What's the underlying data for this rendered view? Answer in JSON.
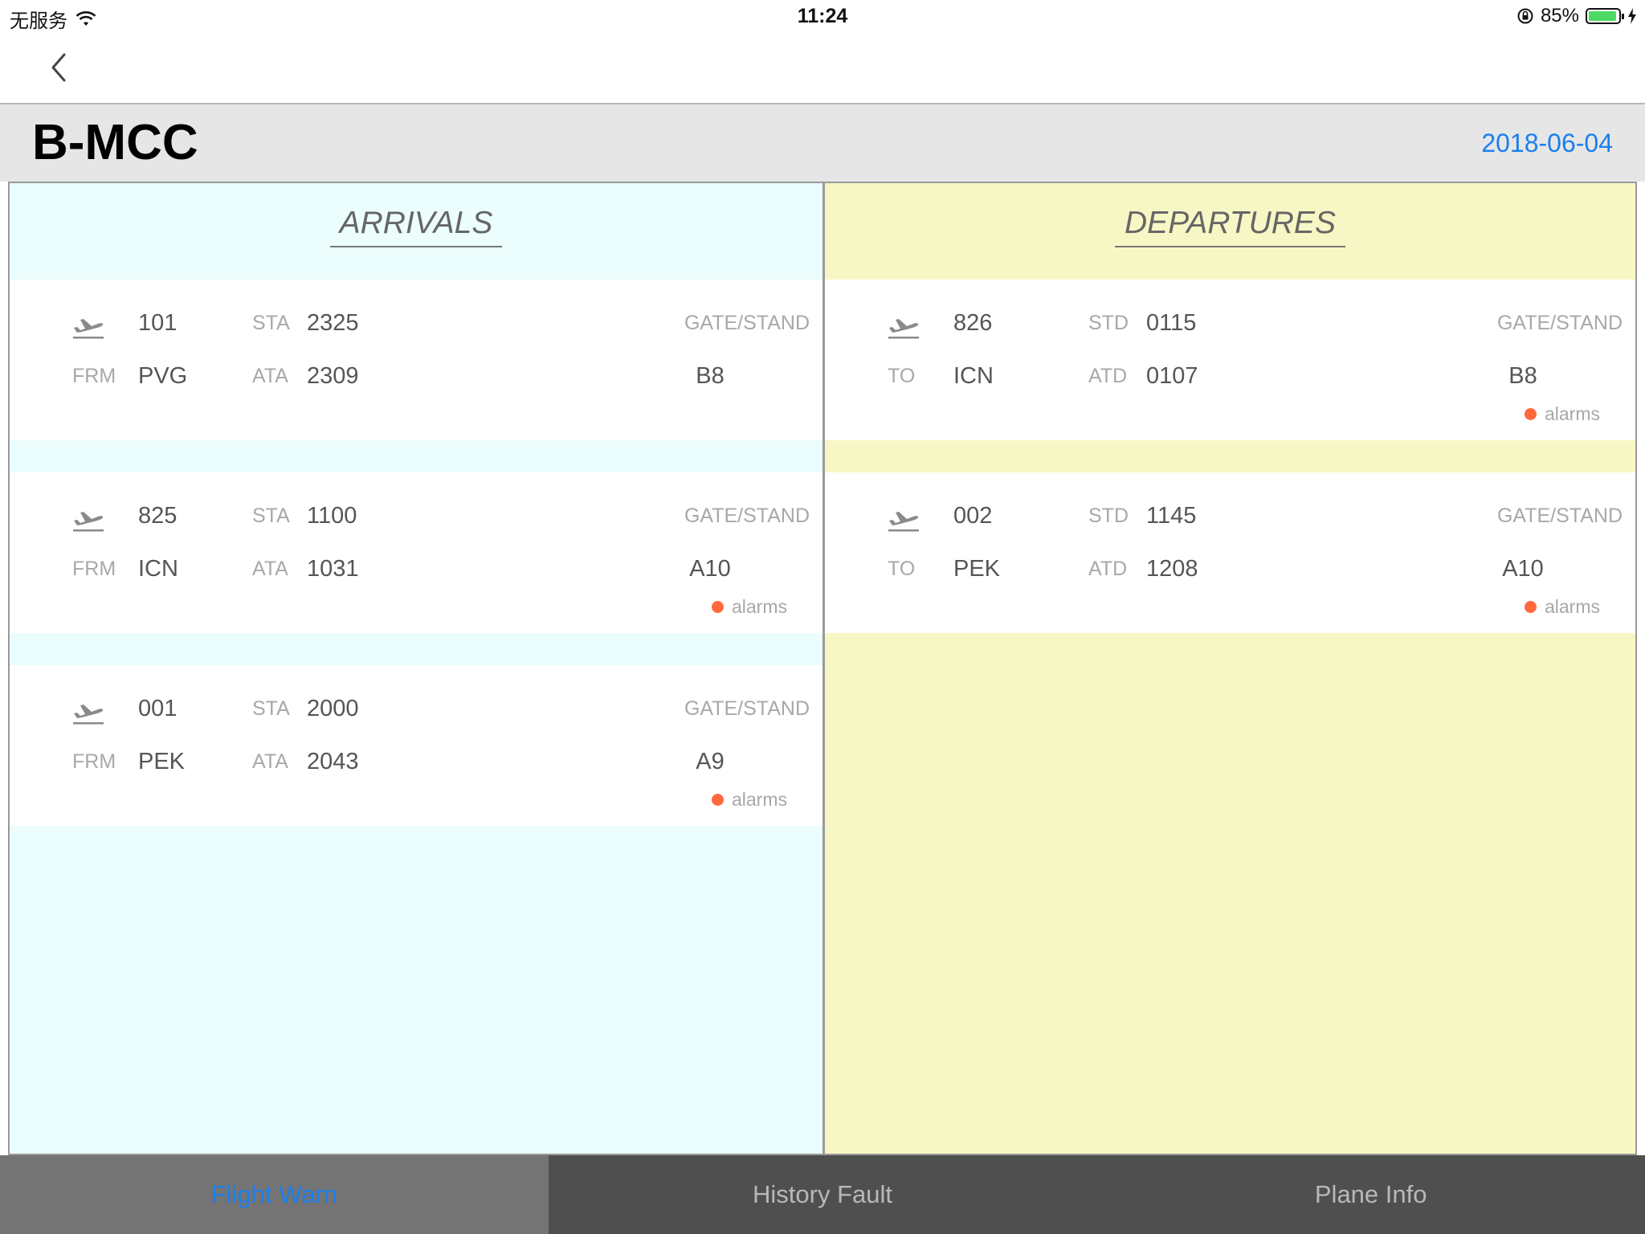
{
  "status_bar": {
    "carrier": "无服务",
    "time": "11:24",
    "battery": "85%",
    "battery_level": 0.85
  },
  "header": {
    "title": "B-MCC",
    "date": "2018-06-04"
  },
  "arrivals": {
    "title": "ARRIVALS",
    "flights": [
      {
        "number": "101",
        "route_label": "FRM",
        "route": "PVG",
        "sched_label": "STA",
        "sched": "2325",
        "actual_label": "ATA",
        "actual": "2309",
        "gate_label": "GATE/STAND",
        "gate": "B8",
        "alarm": ""
      },
      {
        "number": "825",
        "route_label": "FRM",
        "route": "ICN",
        "sched_label": "STA",
        "sched": "1100",
        "actual_label": "ATA",
        "actual": "1031",
        "gate_label": "GATE/STAND",
        "gate": "A10",
        "alarm": "alarms"
      },
      {
        "number": "001",
        "route_label": "FRM",
        "route": "PEK",
        "sched_label": "STA",
        "sched": "2000",
        "actual_label": "ATA",
        "actual": "2043",
        "gate_label": "GATE/STAND",
        "gate": "A9",
        "alarm": "alarms"
      }
    ]
  },
  "departures": {
    "title": "DEPARTURES",
    "flights": [
      {
        "number": "826",
        "route_label": "TO",
        "route": "ICN",
        "sched_label": "STD",
        "sched": "0115",
        "actual_label": "ATD",
        "actual": "0107",
        "gate_label": "GATE/STAND",
        "gate": "B8",
        "alarm": "alarms"
      },
      {
        "number": "002",
        "route_label": "TO",
        "route": "PEK",
        "sched_label": "STD",
        "sched": "1145",
        "actual_label": "ATD",
        "actual": "1208",
        "gate_label": "GATE/STAND",
        "gate": "A10",
        "alarm": "alarms"
      }
    ]
  },
  "tabs": [
    "Flight Warn",
    "History Fault",
    "Plane Info"
  ],
  "colors": {
    "accent": "#1a7ff0",
    "arrivals_bg": "#ebfdfd",
    "departures_bg": "#f7f7c5",
    "alarm": "#ff6a3d"
  }
}
